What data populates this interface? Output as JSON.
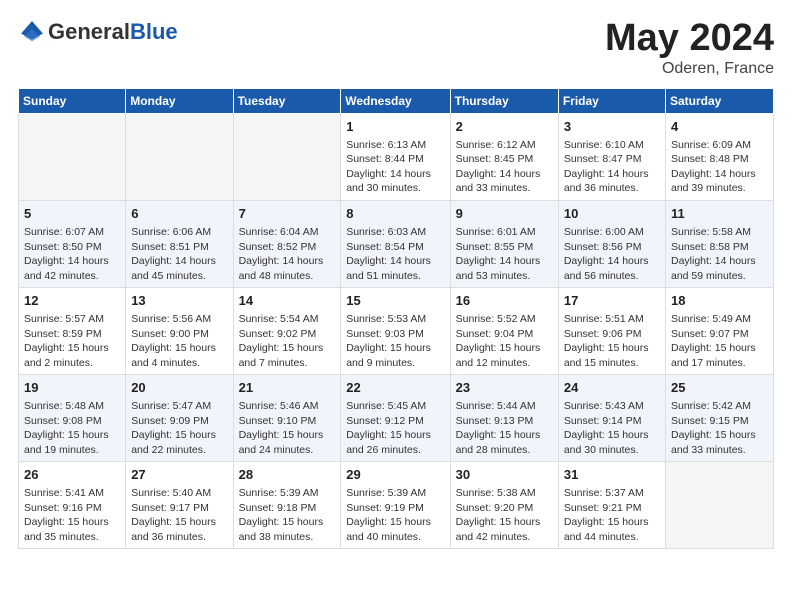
{
  "header": {
    "logo_general": "General",
    "logo_blue": "Blue",
    "month": "May 2024",
    "location": "Oderen, France"
  },
  "weekdays": [
    "Sunday",
    "Monday",
    "Tuesday",
    "Wednesday",
    "Thursday",
    "Friday",
    "Saturday"
  ],
  "weeks": [
    [
      {
        "day": "",
        "info": ""
      },
      {
        "day": "",
        "info": ""
      },
      {
        "day": "",
        "info": ""
      },
      {
        "day": "1",
        "info": "Sunrise: 6:13 AM\nSunset: 8:44 PM\nDaylight: 14 hours\nand 30 minutes."
      },
      {
        "day": "2",
        "info": "Sunrise: 6:12 AM\nSunset: 8:45 PM\nDaylight: 14 hours\nand 33 minutes."
      },
      {
        "day": "3",
        "info": "Sunrise: 6:10 AM\nSunset: 8:47 PM\nDaylight: 14 hours\nand 36 minutes."
      },
      {
        "day": "4",
        "info": "Sunrise: 6:09 AM\nSunset: 8:48 PM\nDaylight: 14 hours\nand 39 minutes."
      }
    ],
    [
      {
        "day": "5",
        "info": "Sunrise: 6:07 AM\nSunset: 8:50 PM\nDaylight: 14 hours\nand 42 minutes."
      },
      {
        "day": "6",
        "info": "Sunrise: 6:06 AM\nSunset: 8:51 PM\nDaylight: 14 hours\nand 45 minutes."
      },
      {
        "day": "7",
        "info": "Sunrise: 6:04 AM\nSunset: 8:52 PM\nDaylight: 14 hours\nand 48 minutes."
      },
      {
        "day": "8",
        "info": "Sunrise: 6:03 AM\nSunset: 8:54 PM\nDaylight: 14 hours\nand 51 minutes."
      },
      {
        "day": "9",
        "info": "Sunrise: 6:01 AM\nSunset: 8:55 PM\nDaylight: 14 hours\nand 53 minutes."
      },
      {
        "day": "10",
        "info": "Sunrise: 6:00 AM\nSunset: 8:56 PM\nDaylight: 14 hours\nand 56 minutes."
      },
      {
        "day": "11",
        "info": "Sunrise: 5:58 AM\nSunset: 8:58 PM\nDaylight: 14 hours\nand 59 minutes."
      }
    ],
    [
      {
        "day": "12",
        "info": "Sunrise: 5:57 AM\nSunset: 8:59 PM\nDaylight: 15 hours\nand 2 minutes."
      },
      {
        "day": "13",
        "info": "Sunrise: 5:56 AM\nSunset: 9:00 PM\nDaylight: 15 hours\nand 4 minutes."
      },
      {
        "day": "14",
        "info": "Sunrise: 5:54 AM\nSunset: 9:02 PM\nDaylight: 15 hours\nand 7 minutes."
      },
      {
        "day": "15",
        "info": "Sunrise: 5:53 AM\nSunset: 9:03 PM\nDaylight: 15 hours\nand 9 minutes."
      },
      {
        "day": "16",
        "info": "Sunrise: 5:52 AM\nSunset: 9:04 PM\nDaylight: 15 hours\nand 12 minutes."
      },
      {
        "day": "17",
        "info": "Sunrise: 5:51 AM\nSunset: 9:06 PM\nDaylight: 15 hours\nand 15 minutes."
      },
      {
        "day": "18",
        "info": "Sunrise: 5:49 AM\nSunset: 9:07 PM\nDaylight: 15 hours\nand 17 minutes."
      }
    ],
    [
      {
        "day": "19",
        "info": "Sunrise: 5:48 AM\nSunset: 9:08 PM\nDaylight: 15 hours\nand 19 minutes."
      },
      {
        "day": "20",
        "info": "Sunrise: 5:47 AM\nSunset: 9:09 PM\nDaylight: 15 hours\nand 22 minutes."
      },
      {
        "day": "21",
        "info": "Sunrise: 5:46 AM\nSunset: 9:10 PM\nDaylight: 15 hours\nand 24 minutes."
      },
      {
        "day": "22",
        "info": "Sunrise: 5:45 AM\nSunset: 9:12 PM\nDaylight: 15 hours\nand 26 minutes."
      },
      {
        "day": "23",
        "info": "Sunrise: 5:44 AM\nSunset: 9:13 PM\nDaylight: 15 hours\nand 28 minutes."
      },
      {
        "day": "24",
        "info": "Sunrise: 5:43 AM\nSunset: 9:14 PM\nDaylight: 15 hours\nand 30 minutes."
      },
      {
        "day": "25",
        "info": "Sunrise: 5:42 AM\nSunset: 9:15 PM\nDaylight: 15 hours\nand 33 minutes."
      }
    ],
    [
      {
        "day": "26",
        "info": "Sunrise: 5:41 AM\nSunset: 9:16 PM\nDaylight: 15 hours\nand 35 minutes."
      },
      {
        "day": "27",
        "info": "Sunrise: 5:40 AM\nSunset: 9:17 PM\nDaylight: 15 hours\nand 36 minutes."
      },
      {
        "day": "28",
        "info": "Sunrise: 5:39 AM\nSunset: 9:18 PM\nDaylight: 15 hours\nand 38 minutes."
      },
      {
        "day": "29",
        "info": "Sunrise: 5:39 AM\nSunset: 9:19 PM\nDaylight: 15 hours\nand 40 minutes."
      },
      {
        "day": "30",
        "info": "Sunrise: 5:38 AM\nSunset: 9:20 PM\nDaylight: 15 hours\nand 42 minutes."
      },
      {
        "day": "31",
        "info": "Sunrise: 5:37 AM\nSunset: 9:21 PM\nDaylight: 15 hours\nand 44 minutes."
      },
      {
        "day": "",
        "info": ""
      }
    ]
  ]
}
